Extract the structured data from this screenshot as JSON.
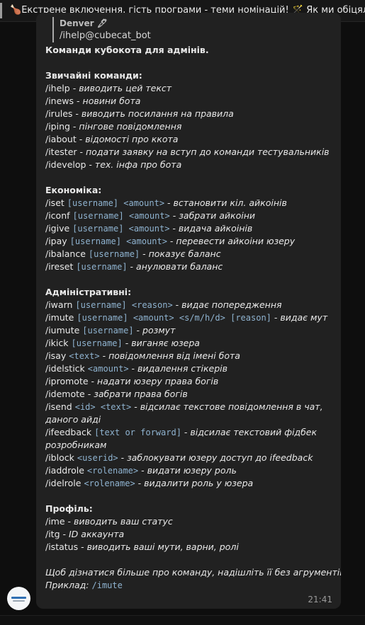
{
  "pinned": {
    "icon": "flame-icon",
    "text": "Екстрене включення, гість програми - теми номінацій!",
    "icon2": "magic-wand-icon",
    "text2": "Як ми обіцяли, г"
  },
  "reply": {
    "author": "Denver",
    "text": "/ihelp@cubecat_bot"
  },
  "message": {
    "title": "Команди кубокота для адмінів.",
    "sections": {
      "ordinary": {
        "header": "Звичайні команди:",
        "rows": [
          {
            "cmd": "/ihelp",
            "desc": "виводить цей текст"
          },
          {
            "cmd": "/inews",
            "desc": "новини бота"
          },
          {
            "cmd": "/irules",
            "desc": "виводить посилання на правила"
          },
          {
            "cmd": "/iping",
            "desc": "пінгове повідомлення"
          },
          {
            "cmd": "/iabout",
            "desc": "відомості про ккота"
          },
          {
            "cmd": "/itester",
            "desc": "подати заявку на вступ до команди тестувальників"
          },
          {
            "cmd": "/idevelop",
            "desc": "тех. інфа про бота"
          }
        ]
      },
      "economy": {
        "header": "Економіка:",
        "rows": [
          {
            "cmd": "/iset",
            "args": "[username] <amount>",
            "desc": "встановити кіл. айкоінів"
          },
          {
            "cmd": "/iconf",
            "args": "[username] <amount>",
            "desc": "забрати айкоіни"
          },
          {
            "cmd": "/igive",
            "args": "[username] <amount>",
            "desc": "видача айкоінів"
          },
          {
            "cmd": "/ipay",
            "args": "[username] <amount>",
            "desc": "перевести айкоіни юзеру"
          },
          {
            "cmd": "/ibalance",
            "args": "[username]",
            "desc": "показує баланс"
          },
          {
            "cmd": "/ireset",
            "args": "[username]",
            "desc": "анулювати баланс"
          }
        ]
      },
      "admin": {
        "header": "Адміністративні:",
        "rows": [
          {
            "cmd": "/iwarn",
            "args": "[username] <reason>",
            "desc": "видає попередження"
          },
          {
            "cmd": "/imute",
            "args": "[username] <amount> <s/m/h/d> [reason]",
            "desc": "видає мут"
          },
          {
            "cmd": "/iumute",
            "args": "[username]",
            "desc": "розмут"
          },
          {
            "cmd": "/ikick",
            "args": "[username]",
            "desc": "виганяє юзера"
          },
          {
            "cmd": "/isay",
            "args": "<text>",
            "desc": "повідомлення від імені бота"
          },
          {
            "cmd": "/idelstick",
            "args": "<amount>",
            "desc": "видалення стікерів"
          },
          {
            "cmd": "/ipromote",
            "args": "",
            "desc": "надати юзеру права богів"
          },
          {
            "cmd": "/idemote",
            "args": "",
            "desc": "забрати права богів"
          },
          {
            "cmd": "/isend",
            "args": "<id> <text>",
            "desc": "відсилає текстове повідомлення в чат, даного айді"
          },
          {
            "cmd": "/ifeedback",
            "args": "[text or forward]",
            "desc": "відсилає текстовий фідбек розробникам"
          },
          {
            "cmd": "/iblock",
            "args": "<userid>",
            "desc": "заблокувати юзеру доступ до ifeedback"
          },
          {
            "cmd": "/iaddrole",
            "args": "<rolename>",
            "desc": "видати юзеру роль"
          },
          {
            "cmd": "/idelrole",
            "args": "<rolename>",
            "desc": "видалити роль у юзера"
          }
        ]
      },
      "profile": {
        "header": "Профіль:",
        "rows": [
          {
            "cmd": "/ime",
            "desc": "виводить ваш статус"
          },
          {
            "cmd": "/itg",
            "desc": "ID аккаунта"
          },
          {
            "cmd": "/istatus",
            "desc": "виводить ваші мути, варни, ролі"
          }
        ]
      }
    },
    "footer": "Щоб дізнатися більше про команду, надішліть її без агрументів.",
    "example_label": "Приклад:",
    "example_cmd": "/imute",
    "sep": " - ",
    "time": "21:41"
  },
  "avatar": {
    "icon": "cubecat-bot-avatar"
  }
}
